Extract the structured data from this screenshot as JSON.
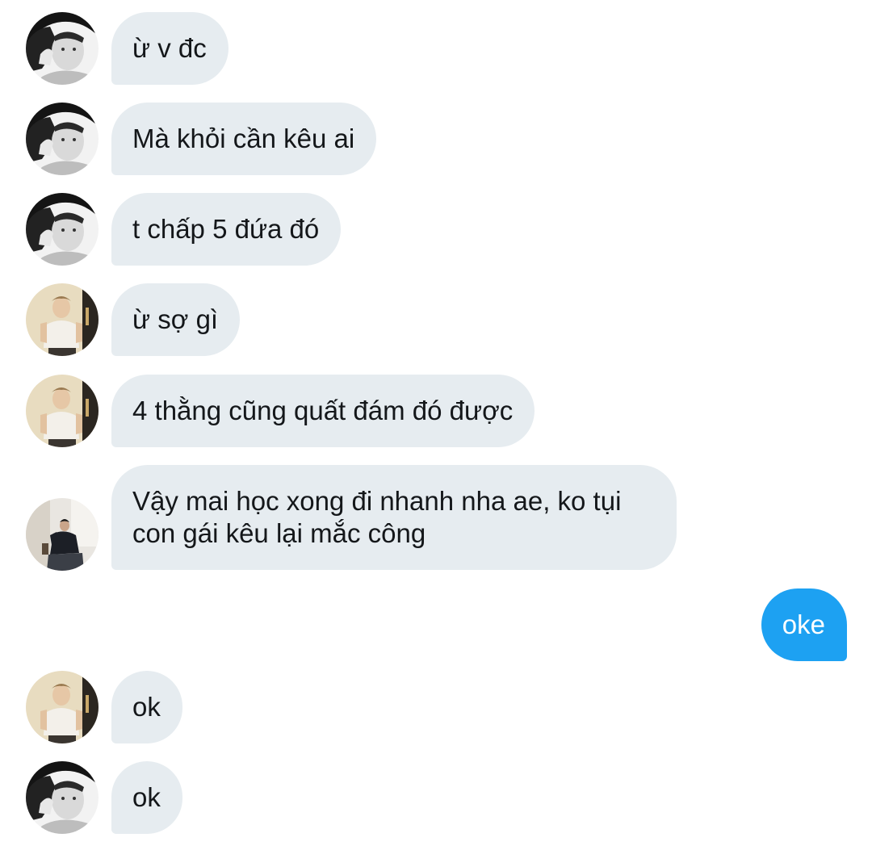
{
  "conversation": {
    "messages": [
      {
        "sender": "A",
        "text": "ừ v đc"
      },
      {
        "sender": "A",
        "text": "Mà khỏi cần kêu ai"
      },
      {
        "sender": "A",
        "text": "t chấp 5 đứa đó"
      },
      {
        "sender": "B",
        "text": "ừ sợ gì"
      },
      {
        "sender": "B",
        "text": "4 thằng cũng quất đám đó được"
      },
      {
        "sender": "C",
        "text": "Vậy mai học xong đi nhanh nha ae, ko tụi con gái kêu lại mắc công"
      },
      {
        "sender": "me",
        "text": "oke"
      },
      {
        "sender": "B",
        "text": "ok"
      },
      {
        "sender": "A",
        "text": "ok"
      }
    ]
  },
  "colors": {
    "incoming_bubble": "#e6ecf0",
    "outgoing_bubble": "#1da1f2",
    "incoming_text": "#14171a",
    "outgoing_text": "#ffffff"
  },
  "icons": {
    "avatar_a": "avatar-icon",
    "avatar_b": "avatar-icon",
    "avatar_c": "avatar-icon"
  }
}
